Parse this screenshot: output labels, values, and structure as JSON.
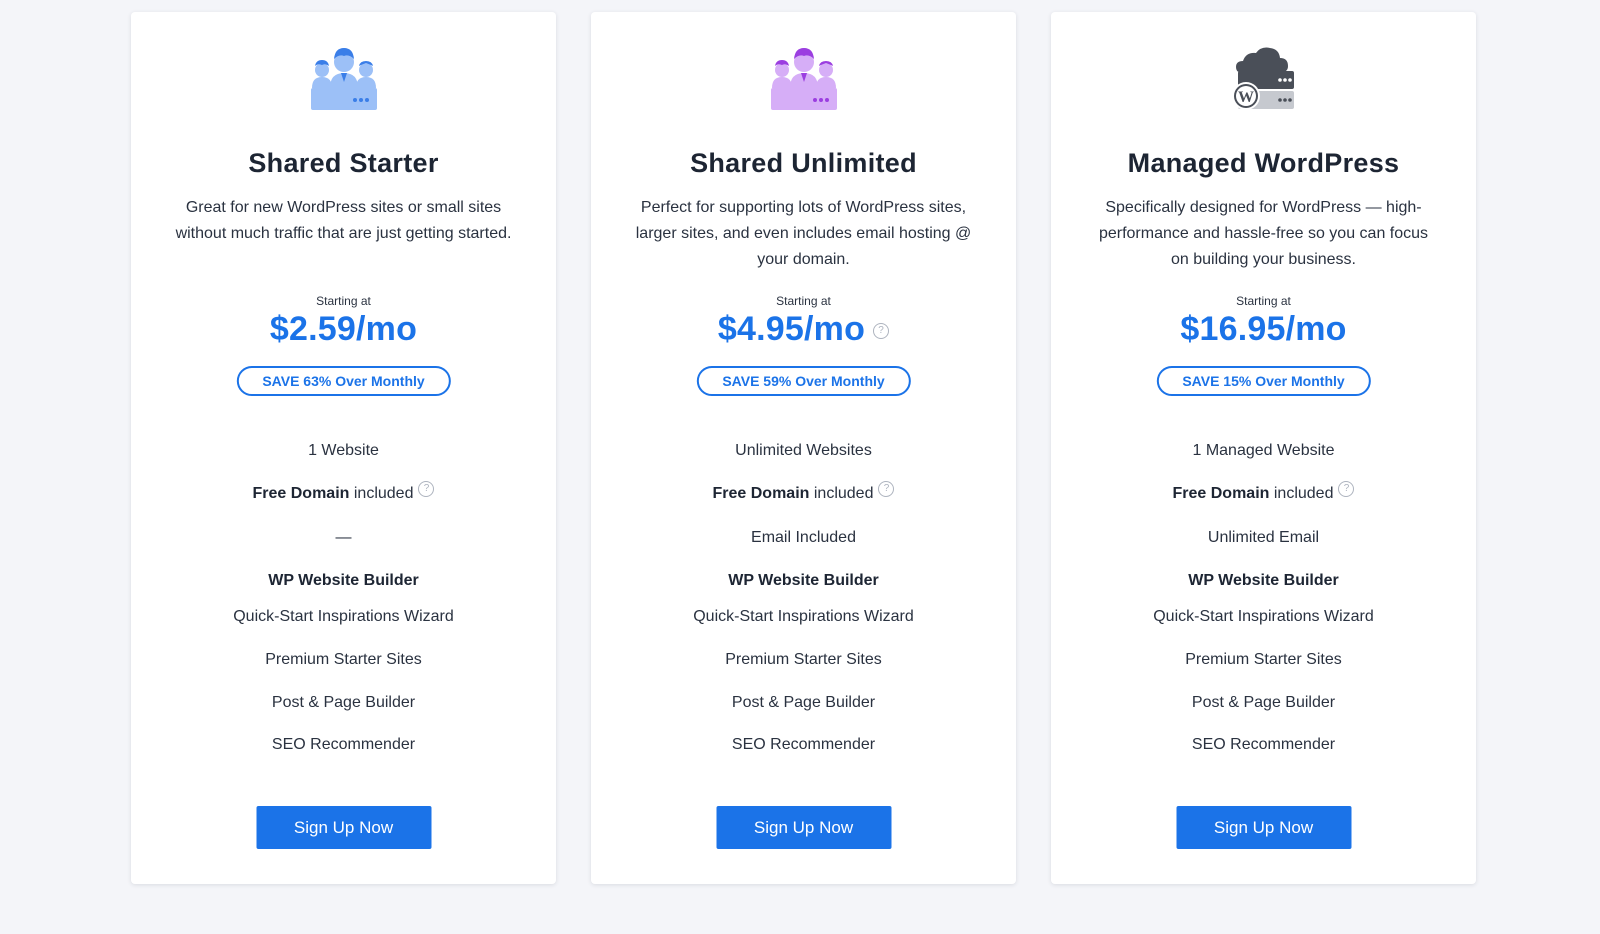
{
  "colors": {
    "accent": "#1b73e8",
    "background": "#f4f5f9",
    "starter_icon": "#9cc0f7",
    "unlimited_icon": "#c79af2",
    "managed_icon": "#4a4f58"
  },
  "plans": [
    {
      "icon": "team-server-icon",
      "title": "Shared Starter",
      "description": "Great for new WordPress sites or small sites without much traffic that are just getting started.",
      "starting_label": "Starting at",
      "price": "$2.59/mo",
      "save_badge": "SAVE 63% Over Monthly",
      "features": {
        "websites": "1 Website",
        "domain_bold": "Free Domain",
        "domain_rest": "included",
        "email": "—",
        "builder": "WP Website Builder",
        "wizard": "Quick-Start Inspirations Wizard",
        "starter_sites": "Premium Starter Sites",
        "page_builder": "Post & Page Builder",
        "seo": "SEO Recommender"
      },
      "cta": "Sign Up Now"
    },
    {
      "icon": "team-server-icon",
      "title": "Shared Unlimited",
      "description": "Perfect for supporting lots of WordPress sites, larger sites, and even includes email hosting @ your domain.",
      "starting_label": "Starting at",
      "price": "$4.95/mo",
      "save_badge": "SAVE 59% Over Monthly",
      "features": {
        "websites": "Unlimited Websites",
        "domain_bold": "Free Domain",
        "domain_rest": "included",
        "email": "Email Included",
        "builder": "WP Website Builder",
        "wizard": "Quick-Start Inspirations Wizard",
        "starter_sites": "Premium Starter Sites",
        "page_builder": "Post & Page Builder",
        "seo": "SEO Recommender"
      },
      "cta": "Sign Up Now"
    },
    {
      "icon": "wordpress-cloud-server-icon",
      "title": "Managed WordPress",
      "description": "Specifically designed for WordPress — high-performance and hassle-free so you can focus on building your business.",
      "starting_label": "Starting at",
      "price": "$16.95/mo",
      "save_badge": "SAVE 15% Over Monthly",
      "features": {
        "websites": "1 Managed Website",
        "domain_bold": "Free Domain",
        "domain_rest": "included",
        "email": "Unlimited Email",
        "builder": "WP Website Builder",
        "wizard": "Quick-Start Inspirations Wizard",
        "starter_sites": "Premium Starter Sites",
        "page_builder": "Post & Page Builder",
        "seo": "SEO Recommender"
      },
      "cta": "Sign Up Now"
    }
  ],
  "help_glyph": "?"
}
